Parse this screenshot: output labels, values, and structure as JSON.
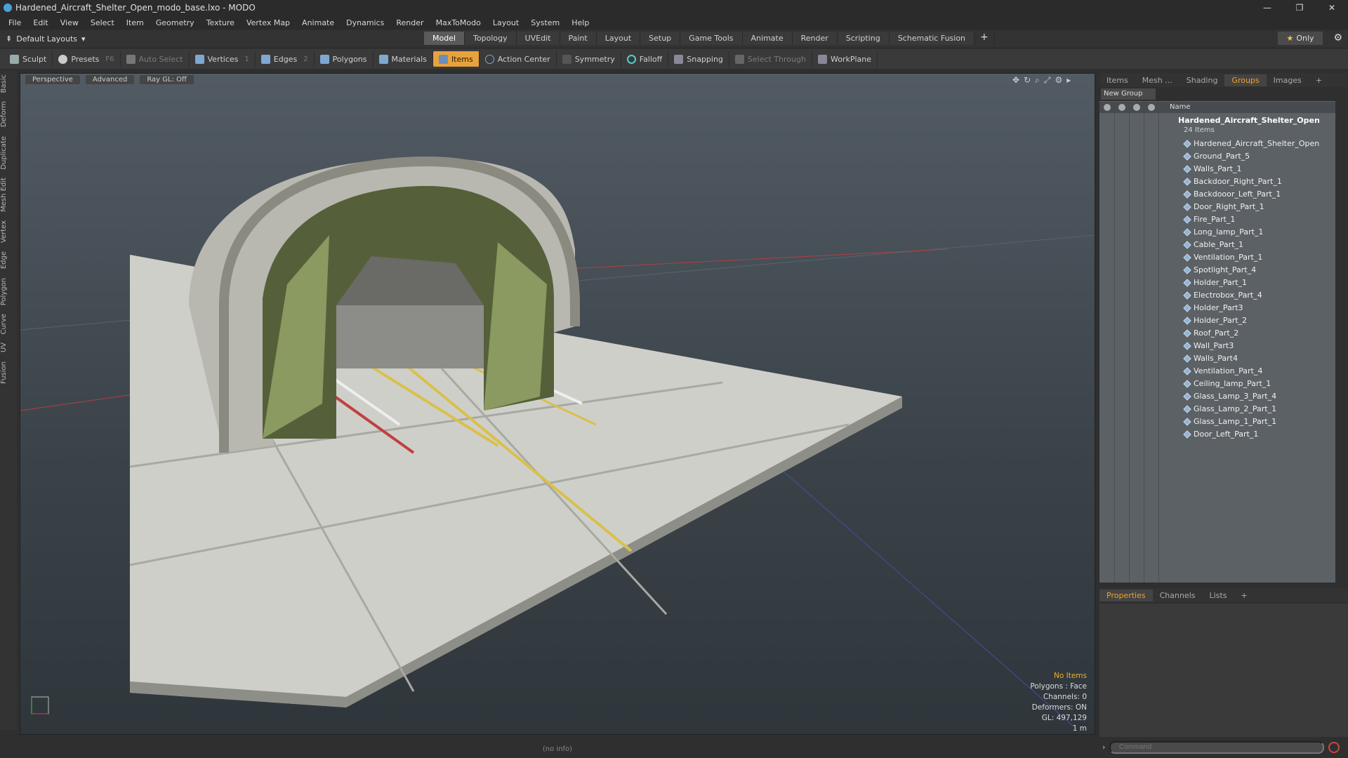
{
  "window": {
    "title": "Hardened_Aircraft_Shelter_Open_modo_base.lxo - MODO",
    "controls": [
      "—",
      "❐",
      "✕"
    ]
  },
  "menu": [
    "File",
    "Edit",
    "View",
    "Select",
    "Item",
    "Geometry",
    "Texture",
    "Vertex Map",
    "Animate",
    "Dynamics",
    "Render",
    "MaxToModo",
    "Layout",
    "System",
    "Help"
  ],
  "layout_selector": "Default Layouts",
  "layout_tabs": [
    "Model",
    "Topology",
    "UVEdit",
    "Paint",
    "Layout",
    "Setup",
    "Game Tools",
    "Animate",
    "Render",
    "Scripting",
    "Schematic Fusion"
  ],
  "active_layout_tab": "Model",
  "only_button": "Only",
  "toolbar": {
    "sculpt": "Sculpt",
    "presets": "Presets",
    "presets_hotkey": "F6",
    "auto_select": "Auto Select",
    "vertices": "Vertices",
    "vertices_count": "1",
    "edges": "Edges",
    "edges_count": "2",
    "polygons": "Polygons",
    "materials": "Materials",
    "items": "Items",
    "action_center": "Action Center",
    "symmetry": "Symmetry",
    "falloff": "Falloff",
    "snapping": "Snapping",
    "select_through": "Select Through",
    "workplane": "WorkPlane"
  },
  "left_tabs": [
    "Basic",
    "Deform",
    "Duplicate",
    "Mesh Edit",
    "Vertex",
    "Edge",
    "Polygon",
    "Curve",
    "UV",
    "Fusion"
  ],
  "viewport": {
    "buttons": [
      "Perspective",
      "Advanced",
      "Ray GL: Off"
    ],
    "info": {
      "selection": "No Items",
      "polygons": "Polygons : Face",
      "channels": "Channels: 0",
      "deformers": "Deformers: ON",
      "gl": "GL: 497,129",
      "scale": "1 m"
    }
  },
  "status_text": "(no info)",
  "right_panel": {
    "tabs": [
      "Items",
      "Mesh ...",
      "Shading",
      "Groups",
      "Images"
    ],
    "active_tab": "Groups",
    "new_group": "New Group",
    "name_header": "Name",
    "group_name": "Hardened_Aircraft_Shelter_Open",
    "item_count": "24 Items",
    "items": [
      "Hardened_Aircraft_Shelter_Open",
      "Ground_Part_5",
      "Walls_Part_1",
      "Backdoor_Right_Part_1",
      "Backdooor_Left_Part_1",
      "Door_Right_Part_1",
      "Fire_Part_1",
      "Long_lamp_Part_1",
      "Cable_Part_1",
      "Ventilation_Part_1",
      "Spotlight_Part_4",
      "Holder_Part_1",
      "Electrobox_Part_4",
      "Holder_Part3",
      "Holder_Part_2",
      "Roof_Part_2",
      "Wall_Part3",
      "Walls_Part4",
      "Ventilation_Part_4",
      "Ceiling_lamp_Part_1",
      "Glass_Lamp_3_Part_4",
      "Glass_Lamp_2_Part_1",
      "Glass_Lamp_1_Part_1",
      "Door_Left_Part_1"
    ]
  },
  "properties_panel": {
    "tabs": [
      "Properties",
      "Channels",
      "Lists"
    ],
    "active_tab": "Properties"
  },
  "command_placeholder": "Command",
  "colors": {
    "accent": "#e9a23b",
    "panel_bg": "#5c6166",
    "viewport_top": "#525b64"
  }
}
